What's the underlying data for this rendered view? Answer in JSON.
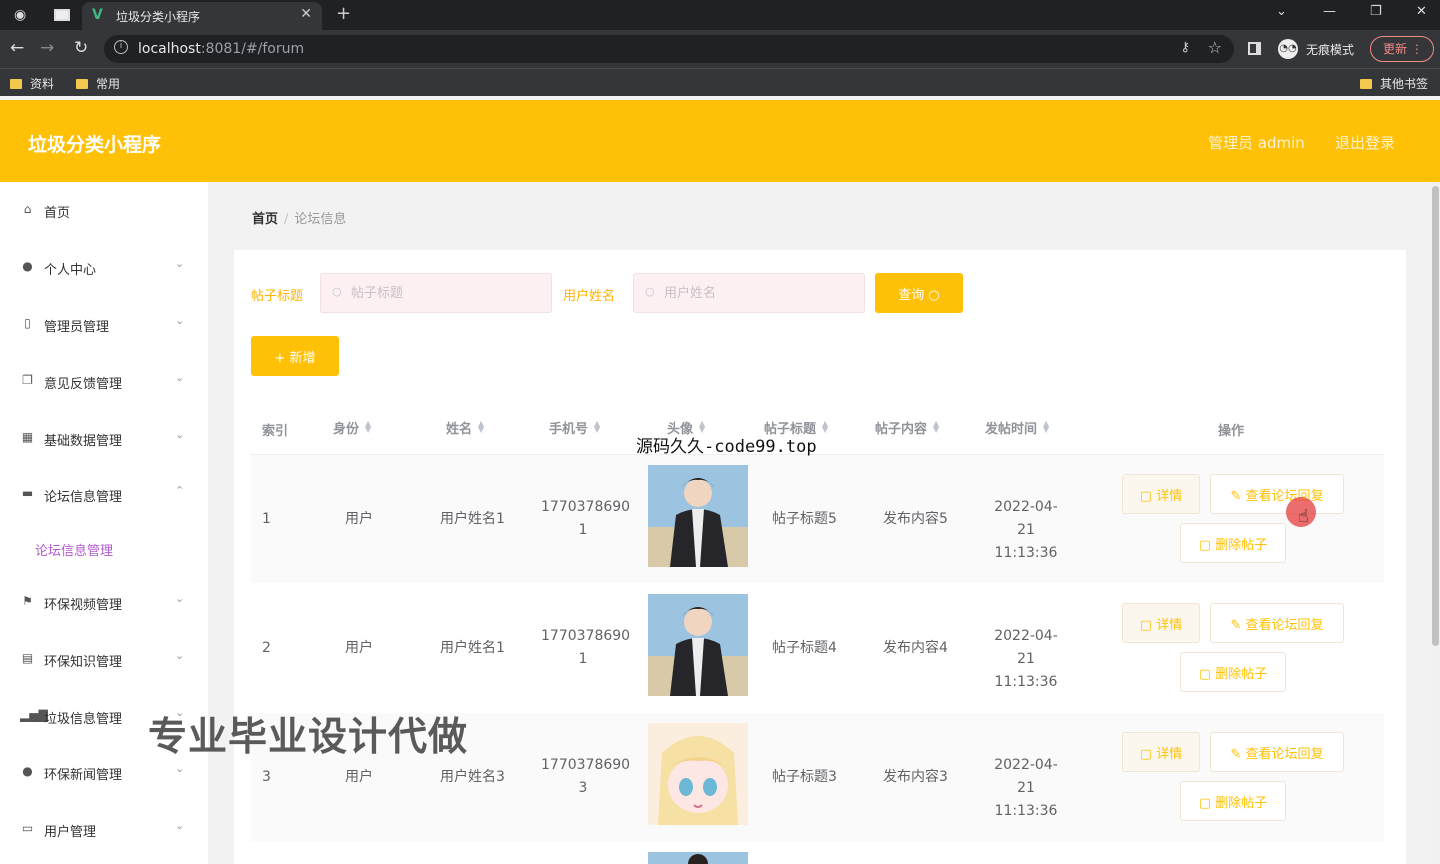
{
  "browser": {
    "tab_title": "垃圾分类小程序",
    "url_host": "localhost",
    "url_rest": ":8081/#/forum",
    "incognito_label": "无痕模式",
    "update_label": "更新",
    "bookmarks": [
      "资料",
      "常用"
    ],
    "other_bookmarks": "其他书签"
  },
  "header": {
    "title": "垃圾分类小程序",
    "user": "管理员 admin",
    "logout": "退出登录"
  },
  "sidebar": {
    "items": [
      {
        "label": "首页",
        "icon": "home-icon"
      },
      {
        "label": "个人中心",
        "icon": "user-icon"
      },
      {
        "label": "管理员管理",
        "icon": "phone-icon"
      },
      {
        "label": "意见反馈管理",
        "icon": "copy-icon"
      },
      {
        "label": "基础数据管理",
        "icon": "grid-icon"
      },
      {
        "label": "论坛信息管理",
        "icon": "monitor-icon"
      },
      {
        "label": "环保视频管理",
        "icon": "flag-icon"
      },
      {
        "label": "环保知识管理",
        "icon": "document-icon"
      },
      {
        "label": "垃圾信息管理",
        "icon": "bar-chart-icon"
      },
      {
        "label": "环保新闻管理",
        "icon": "bulb-icon"
      },
      {
        "label": "用户管理",
        "icon": "chat-icon"
      }
    ],
    "active_sub": "论坛信息管理"
  },
  "breadcrumb": {
    "home": "首页",
    "current": "论坛信息"
  },
  "search": {
    "title_label": "帖子标题",
    "title_placeholder": "帖子标题",
    "name_label": "用户姓名",
    "name_placeholder": "用户姓名",
    "query_label": "查询"
  },
  "actions": {
    "add_label": "新增"
  },
  "table": {
    "headers": [
      "索引",
      "身份",
      "姓名",
      "手机号",
      "头像",
      "帖子标题",
      "帖子内容",
      "发帖时间",
      "操作"
    ],
    "rows": [
      {
        "index": "1",
        "role": "用户",
        "name": "用户姓名1",
        "phone_a": "1770378690",
        "phone_b": "1",
        "title": "帖子标题5",
        "content": "发布内容5",
        "date": "2022-04-21",
        "time": "11:13:36"
      },
      {
        "index": "2",
        "role": "用户",
        "name": "用户姓名1",
        "phone_a": "1770378690",
        "phone_b": "1",
        "title": "帖子标题4",
        "content": "发布内容4",
        "date": "2022-04-21",
        "time": "11:13:36"
      },
      {
        "index": "3",
        "role": "用户",
        "name": "用户姓名3",
        "phone_a": "1770378690",
        "phone_b": "3",
        "title": "帖子标题3",
        "content": "发布内容3",
        "date": "2022-04-21",
        "time": "11:13:36"
      }
    ],
    "btn_detail": "详情",
    "btn_replies": "查看论坛回复",
    "btn_delete": "删除帖子"
  },
  "overlay": {
    "code_watermark": "源码久久-code99.top",
    "promo": "专业毕业设计代做"
  },
  "colors": {
    "brand": "#ffc107",
    "active_sub": "#b45ad0"
  }
}
